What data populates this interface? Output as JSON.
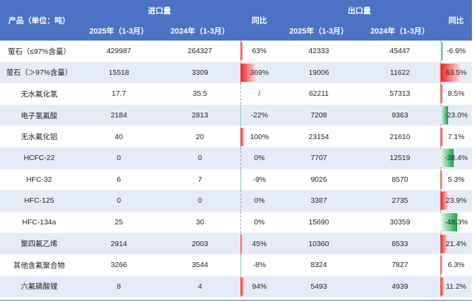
{
  "header": {
    "product_label": "产品（单位：吨）",
    "import_label": "进口量",
    "export_label": "出口量",
    "yoy_label": "同比",
    "col_2025": "2025年（1-3月）",
    "col_2024": "2024年（1-3月）"
  },
  "colors": {
    "header_bg": "#4a73c4",
    "stripe": "#e6ecf7",
    "pos_bar": "#f0201f",
    "neg_bar": "#1aa24a"
  },
  "rows": [
    {
      "product": "萤石（≤97%含量）",
      "imp_2025": "429987",
      "imp_2024": "264327",
      "imp_yoy": "63%",
      "imp_yoy_val": 63,
      "exp_2025": "42333",
      "exp_2024": "45447",
      "exp_yoy": "-6.9%",
      "exp_yoy_val": -6.9
    },
    {
      "product": "萤石（＞97%含量）",
      "imp_2025": "15518",
      "imp_2024": "3309",
      "imp_yoy": "369%",
      "imp_yoy_val": 369,
      "exp_2025": "19006",
      "exp_2024": "11622",
      "exp_yoy": "63.5%",
      "exp_yoy_val": 63.5
    },
    {
      "product": "无水氟化氢",
      "imp_2025": "17.7",
      "imp_2024": "35.5",
      "imp_yoy": "/",
      "imp_yoy_val": 0,
      "exp_2025": "62211",
      "exp_2024": "57313",
      "exp_yoy": "8.5%",
      "exp_yoy_val": 8.5
    },
    {
      "product": "电子氢氟酸",
      "imp_2025": "2184",
      "imp_2024": "2813",
      "imp_yoy": "-22%",
      "imp_yoy_val": -22,
      "exp_2025": "7208",
      "exp_2024": "9363",
      "exp_yoy": "-23.0%",
      "exp_yoy_val": -23.0
    },
    {
      "product": "无水氟化铝",
      "imp_2025": "40",
      "imp_2024": "20",
      "imp_yoy": "100%",
      "imp_yoy_val": 100,
      "exp_2025": "23154",
      "exp_2024": "21610",
      "exp_yoy": "7.1%",
      "exp_yoy_val": 7.1
    },
    {
      "product": "HCFC-22",
      "imp_2025": "0",
      "imp_2024": "0",
      "imp_yoy": "0%",
      "imp_yoy_val": 0,
      "exp_2025": "7707",
      "exp_2024": "12519",
      "exp_yoy": "-38.4%",
      "exp_yoy_val": -38.4
    },
    {
      "product": "HFC-32",
      "imp_2025": "6",
      "imp_2024": "7",
      "imp_yoy": "-9%",
      "imp_yoy_val": -9,
      "exp_2025": "9026",
      "exp_2024": "8570",
      "exp_yoy": "5.3%",
      "exp_yoy_val": 5.3
    },
    {
      "product": "HFC-125",
      "imp_2025": "0",
      "imp_2024": "0",
      "imp_yoy": "0%",
      "imp_yoy_val": 0,
      "exp_2025": "3387",
      "exp_2024": "2735",
      "exp_yoy": "23.9%",
      "exp_yoy_val": 23.9
    },
    {
      "product": "HFC-134a",
      "imp_2025": "25",
      "imp_2024": "30",
      "imp_yoy": "0%",
      "imp_yoy_val": 0,
      "exp_2025": "15690",
      "exp_2024": "30359",
      "exp_yoy": "-48.3%",
      "exp_yoy_val": -48.3
    },
    {
      "product": "聚四氟乙烯",
      "imp_2025": "2914",
      "imp_2024": "2003",
      "imp_yoy": "45%",
      "imp_yoy_val": 45,
      "exp_2025": "10360",
      "exp_2024": "8533",
      "exp_yoy": "21.4%",
      "exp_yoy_val": 21.4
    },
    {
      "product": "其他含氟聚合物",
      "imp_2025": "3266",
      "imp_2024": "3544",
      "imp_yoy": "-8%",
      "imp_yoy_val": -8,
      "exp_2025": "8324",
      "exp_2024": "7827",
      "exp_yoy": "6.3%",
      "exp_yoy_val": 6.3
    },
    {
      "product": "六氟磷酸锂",
      "imp_2025": "8",
      "imp_2024": "4",
      "imp_yoy": "94%",
      "imp_yoy_val": 94,
      "exp_2025": "5493",
      "exp_2024": "4939",
      "exp_yoy": "11.2%",
      "exp_yoy_val": 11.2
    }
  ]
}
